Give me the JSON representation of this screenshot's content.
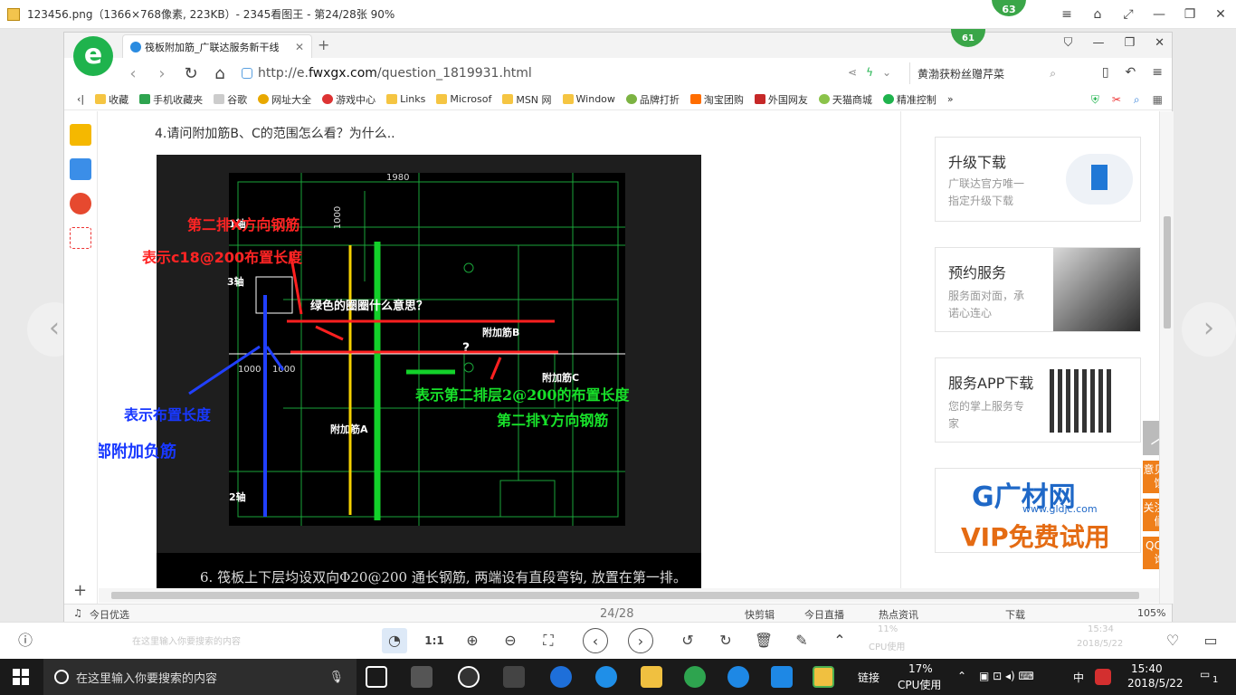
{
  "viewer": {
    "title": "123456.png（1366×768像素, 223KB）- 2345看图王 - 第24/28张 90%",
    "badge": "63",
    "page_counter": "24/28",
    "zoom_one": "1:1"
  },
  "browser": {
    "tab_title": "筏板附加筋_广联达服务新干线",
    "badge": "61",
    "url_prefix": "http://e.",
    "url_domain": "fwxgx.com",
    "url_path": "/question_1819931.html",
    "search_text": "黄渤获粉丝赠芹菜",
    "bookmarks": [
      "收藏",
      "手机收藏夹",
      "谷歌",
      "网址大全",
      "游戏中心",
      "Links",
      "Microsof",
      "MSN 网",
      "Window",
      "品牌打折",
      "淘宝团购",
      "外国网友",
      "天猫商城",
      "精准控制"
    ]
  },
  "question": {
    "text": "4.请问附加筋B、C的范围怎么看？为什么.."
  },
  "cad": {
    "ann_red1": "第二排X方向钢筋",
    "ann_red2": "表示c18@200布置长度",
    "ann_white_q": "绿色的圈圈什么意思？",
    "ann_blue1": "表示布置长度",
    "ann_blue2": "筏板下部附加负筋",
    "ann_green1": "表示第二排层2@200的布置长度",
    "ann_green2": "第二排Y方向钢筋",
    "lbl_axis1": "1轴",
    "lbl_axis3": "3轴",
    "lbl_axis2": "2轴",
    "lbl_A": "附加筋A",
    "lbl_B": "附加筋B",
    "lbl_C": "附加筋C",
    "lbl_q": "?",
    "dim_1980": "1980",
    "dim_1000": "1000",
    "dim_1000b": "1000",
    "dim_1000c": "1000",
    "bottom_note": "6. 筏板上下层均设双向Φ20@200 通长钢筋, 两端设有直段弯钩, 放置在第一排。"
  },
  "sidebar": {
    "card1_title": "升级下载",
    "card1_desc1": "广联达官方唯一",
    "card1_desc2": "指定升级下载",
    "card2_title": "预约服务",
    "card2_desc1": "服务面对面，承",
    "card2_desc2": "诺心连心",
    "card3_title": "服务APP下载",
    "card3_desc1": "您的掌上服务专",
    "card3_desc2": "家",
    "gc_logo": "G广材网",
    "gc_sub": "www.gldjc.com",
    "gc_vip": "VIP免费试用"
  },
  "float": {
    "top": "︿",
    "feedback": "意见反馈",
    "follow": "关注我们",
    "qq": "QQ咨询"
  },
  "status": {
    "left": "今日优选",
    "page": "24/28",
    "items": [
      "快剪辑",
      "今日直播",
      "热点资讯",
      "下载"
    ],
    "zoom": "105%"
  },
  "taskbar": {
    "search_placeholder": "在这里输入你要搜索的内容",
    "link": "链接",
    "cpu_pct": "17%",
    "cpu_label": "CPU使用",
    "ime": "中",
    "time": "15:40",
    "date": "2018/5/22",
    "notif": "1",
    "ghost_cpu": "11%",
    "ghost_cpu_label": "CPU使用",
    "ghost_time": "15:34",
    "ghost_date": "2018/5/22",
    "ghost_search": "在这里输入你要搜索的内容"
  }
}
